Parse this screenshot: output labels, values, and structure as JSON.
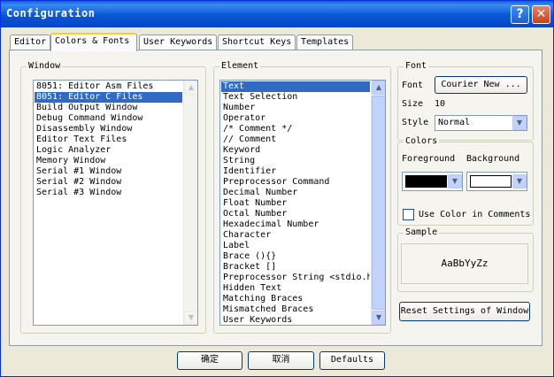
{
  "window": {
    "title": "Configuration",
    "help_label": "?",
    "close_label": "✕"
  },
  "tabs": [
    {
      "label": "Editor"
    },
    {
      "label": "Colors & Fonts"
    },
    {
      "label": "User Keywords"
    },
    {
      "label": "Shortcut Keys"
    },
    {
      "label": "Templates"
    }
  ],
  "window_group": {
    "legend": "Window",
    "items": [
      "8051: Editor Asm Files",
      "8051: Editor C Files",
      "Build Output Window",
      "Debug Command Window",
      "Disassembly Window",
      "Editor Text Files",
      "Logic Analyzer",
      "Memory Window",
      "Serial #1 Window",
      "Serial #2 Window",
      "Serial #3 Window"
    ],
    "selected_index": 1
  },
  "element_group": {
    "legend": "Element",
    "items": [
      "Text",
      "Text Selection",
      "Number",
      "Operator",
      "/* Comment */",
      "// Comment",
      "Keyword",
      "String",
      "Identifier",
      "Preprocessor Command",
      "Decimal Number",
      "Float Number",
      "Octal Number",
      "Hexadecimal Number",
      "Character",
      "Label",
      "Brace (){}",
      "Bracket []",
      "Preprocessor String <stdio.h",
      "Hidden Text",
      "Matching Braces",
      "Mismatched Braces",
      "User Keywords"
    ],
    "selected_index": 0
  },
  "font_group": {
    "legend": "Font",
    "font_label": "Font",
    "font_button": "Courier New ...",
    "size_label": "Size",
    "size_value": "10",
    "style_label": "Style",
    "style_value": "Normal"
  },
  "colors_group": {
    "legend": "Colors",
    "foreground_label": "Foreground",
    "background_label": "Background",
    "foreground_color": "#000000",
    "background_color": "#ffffff",
    "use_color_label": "Use Color in Comments",
    "use_color_checked": false
  },
  "sample_group": {
    "legend": "Sample",
    "text": "AaBbYyZz"
  },
  "reset_button": "Reset Settings of Window",
  "footer": {
    "ok": "确定",
    "cancel": "取消",
    "defaults": "Defaults"
  },
  "icons": {
    "scroll_up": "▲",
    "scroll_down": "▼",
    "dropdown": "▼"
  }
}
